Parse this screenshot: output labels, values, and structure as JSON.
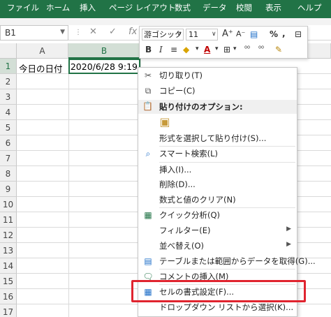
{
  "ribbon": {
    "tabs": [
      "ファイル",
      "ホーム",
      "挿入",
      "ページ レイアウト",
      "数式",
      "データ",
      "校閲",
      "表示",
      "ヘルプ"
    ]
  },
  "formula_bar": {
    "name_box": "B1",
    "fx": "fx"
  },
  "grid": {
    "columns": [
      "A",
      "B",
      "C"
    ],
    "rows": [
      "1",
      "2",
      "3",
      "4",
      "5",
      "6",
      "7",
      "8",
      "9",
      "10",
      "11",
      "12",
      "13",
      "14",
      "15",
      "16",
      "17"
    ],
    "cell_a1": "今日の日付",
    "cell_b1": "2020/6/28 9:19"
  },
  "mini_toolbar": {
    "font": "游ゴシック",
    "size": "11",
    "bold": "B",
    "italic": "I",
    "percent": "%",
    "comma": ","
  },
  "context_menu": {
    "items": {
      "cut": "切り取り(T)",
      "copy": "コピー(C)",
      "paste_options": "貼り付けのオプション:",
      "paste_special": "形式を選択して貼り付け(S)...",
      "smart_lookup": "スマート検索(L)",
      "insert": "挿入(I)...",
      "delete": "削除(D)...",
      "clear": "数式と値のクリア(N)",
      "quick_analysis": "クイック分析(Q)",
      "filter": "フィルター(E)",
      "sort": "並べ替え(O)",
      "get_data": "テーブルまたは範囲からデータを取得(G)...",
      "insert_comment": "コメントの挿入(M)",
      "format_cells": "セルの書式設定(F)...",
      "dropdown": "ドロップダウン リストから選択(K)..."
    }
  },
  "colors": {
    "ribbon": "#217346",
    "highlight": "#e0242f",
    "selection": "#217346"
  }
}
